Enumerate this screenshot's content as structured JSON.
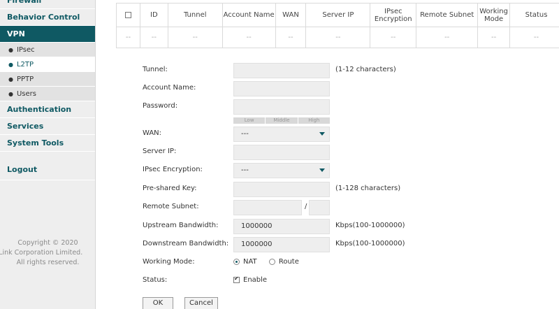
{
  "sidebar": {
    "items": [
      {
        "label": "Firewall"
      },
      {
        "label": "Behavior Control"
      },
      {
        "label": "VPN"
      },
      {
        "label": "Authentication"
      },
      {
        "label": "Services"
      },
      {
        "label": "System Tools"
      },
      {
        "label": "Logout"
      }
    ],
    "vpn_sub": [
      {
        "label": "IPsec"
      },
      {
        "label": "L2TP"
      },
      {
        "label": "PPTP"
      },
      {
        "label": "Users"
      }
    ],
    "copyright": [
      "Copyright © 2020",
      "-Link Corporation Limited.",
      "All rights reserved."
    ]
  },
  "table": {
    "headers": [
      "ID",
      "Tunnel",
      "Account Name",
      "WAN",
      "Server IP",
      "IPsec Encryption",
      "Remote Subnet",
      "Working Mode",
      "Status"
    ],
    "empty_row": [
      "--",
      "--",
      "--",
      "--",
      "--",
      "--",
      "--",
      "--",
      "--",
      "--"
    ]
  },
  "form": {
    "tunnel": {
      "label": "Tunnel:",
      "hint": "(1-12 characters)",
      "value": ""
    },
    "account_name": {
      "label": "Account Name:",
      "value": ""
    },
    "password": {
      "label": "Password:",
      "value": "",
      "strength": [
        "Low",
        "Middle",
        "High"
      ]
    },
    "wan": {
      "label": "WAN:",
      "value": "---"
    },
    "server_ip": {
      "label": "Server IP:",
      "value": ""
    },
    "ipsec_encryption": {
      "label": "IPsec Encryption:",
      "value": "---"
    },
    "psk": {
      "label": "Pre-shared Key:",
      "hint": "(1-128 characters)",
      "value": ""
    },
    "remote_subnet": {
      "label": "Remote Subnet:",
      "separator": "/",
      "value": ""
    },
    "upstream": {
      "label": "Upstream Bandwidth:",
      "value": "1000000",
      "hint": "Kbps(100-1000000)"
    },
    "downstream": {
      "label": "Downstream Bandwidth:",
      "value": "1000000",
      "hint": "Kbps(100-1000000)"
    },
    "working_mode": {
      "label": "Working Mode:",
      "options": [
        "NAT",
        "Route"
      ],
      "selected": "NAT"
    },
    "status": {
      "label": "Status:",
      "checkbox_label": "Enable",
      "checked": true
    },
    "ok_label": "OK",
    "cancel_label": "Cancel"
  },
  "colors": {
    "accent": "#0f5963",
    "sidebar_bg": "#eeeeee"
  }
}
